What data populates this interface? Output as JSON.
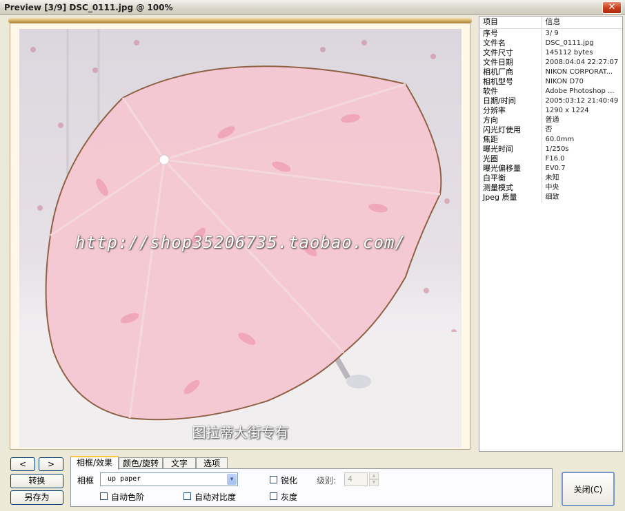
{
  "window": {
    "title": "Preview [3/9] DSC_0111.jpg @ 100%",
    "close_glyph": "✕"
  },
  "photo": {
    "watermark_url": "http://shop35206735.taobao.com/",
    "watermark_caption": "图拉蒂大街专有"
  },
  "info": {
    "headers": {
      "key": "项目",
      "value": "信息"
    },
    "rows": [
      {
        "key": "序号",
        "value": "3/ 9"
      },
      {
        "key": "文件名",
        "value": "DSC_0111.jpg"
      },
      {
        "key": "文件尺寸",
        "value": "145112 bytes"
      },
      {
        "key": "文件日期",
        "value": "2008:04:04 22:27:07"
      },
      {
        "key": "相机厂商",
        "value": "NIKON CORPORAT..."
      },
      {
        "key": "相机型号",
        "value": "NIKON D70"
      },
      {
        "key": "软件",
        "value": "Adobe Photoshop ..."
      },
      {
        "key": "日期/时间",
        "value": "2005:03:12 21:40:49"
      },
      {
        "key": "分辨率",
        "value": "1290 x 1224"
      },
      {
        "key": "方向",
        "value": "普通"
      },
      {
        "key": "闪光灯使用",
        "value": "否"
      },
      {
        "key": "焦距",
        "value": "60.0mm"
      },
      {
        "key": "曝光时间",
        "value": "1/250s"
      },
      {
        "key": "光圈",
        "value": "F16.0"
      },
      {
        "key": "曝光偏移量",
        "value": "EV0.7"
      },
      {
        "key": "白平衡",
        "value": "未知"
      },
      {
        "key": "测量模式",
        "value": "中央"
      },
      {
        "key": "Jpeg 质量",
        "value": "细致"
      }
    ]
  },
  "nav": {
    "prev": "<",
    "next": ">",
    "convert": "转换",
    "save_as": "另存为"
  },
  "tabs": [
    "相框/效果",
    "颜色/旋转",
    "文字",
    "选项"
  ],
  "frame_panel": {
    "frame_label": "相框",
    "frame_value": "up paper",
    "sharpen_label": "锐化",
    "level_label": "级别:",
    "level_value": "4",
    "auto_levels_label": "自动色阶",
    "auto_contrast_label": "自动对比度",
    "grayscale_label": "灰度"
  },
  "close_button": "关闭(C)"
}
